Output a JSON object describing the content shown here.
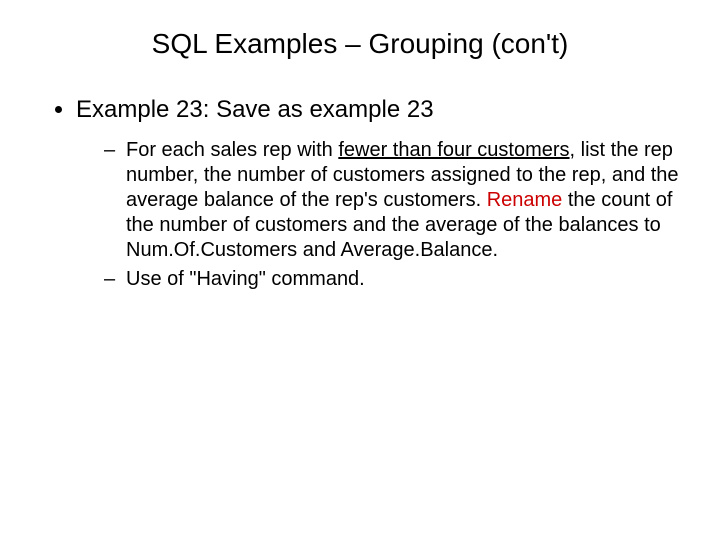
{
  "title": "SQL Examples – Grouping (con't)",
  "bullet1": "Example 23: Save as example 23",
  "sub1_a": "For each sales rep with ",
  "sub1_b_ul": "fewer than four customers",
  "sub1_c": ", list the rep number, the number of customers assigned to the rep, and the average balance of the rep's customers. ",
  "sub1_d_red": "Rename",
  "sub1_e": " the count of the number of customers and the average of the balances to Num.Of.Customers and Average.Balance.",
  "sub2": "Use of \"Having\" command."
}
